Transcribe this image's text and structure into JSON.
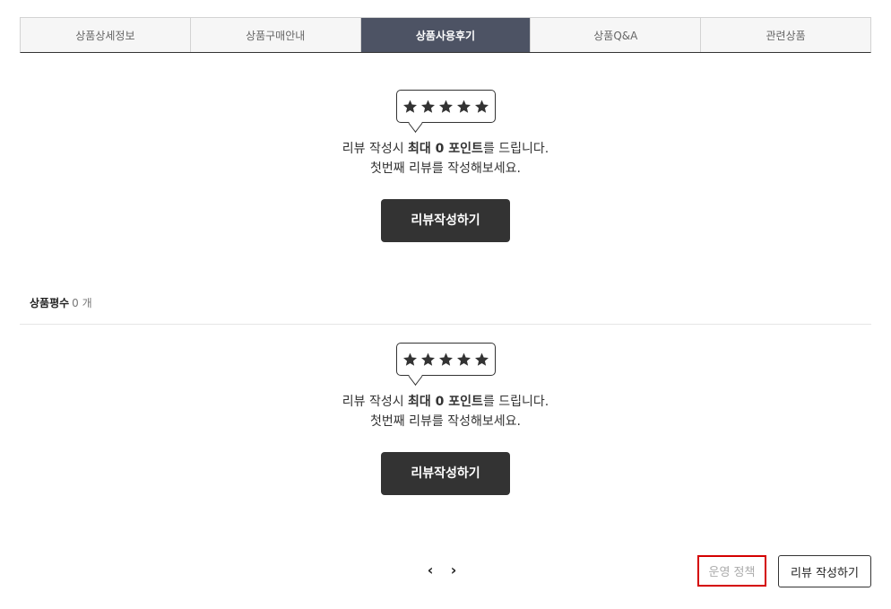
{
  "tabs": [
    {
      "label": "상품상세정보",
      "active": false
    },
    {
      "label": "상품구매안내",
      "active": false
    },
    {
      "label": "상품사용후기",
      "active": true
    },
    {
      "label": "상품Q&A",
      "active": false
    },
    {
      "label": "관련상품",
      "active": false
    }
  ],
  "empty_review": {
    "stars": 5,
    "star_icon": "star-icon",
    "line1_prefix": "리뷰 작성시 ",
    "line1_bold": "최대 0 포인트",
    "line1_suffix": "를 드립니다.",
    "line2": "첫번째 리뷰를 작성해보세요.",
    "button_label": "리뷰작성하기"
  },
  "rating_count": {
    "label": "상품평수",
    "value": "0 개"
  },
  "pagination": {
    "prev_icon": "chevron-left-icon",
    "next_icon": "chevron-right-icon",
    "prev_glyph": "‹",
    "next_glyph": "›"
  },
  "footer": {
    "policy_label": "운영 정책",
    "write_label": "리뷰 작성하기"
  },
  "colors": {
    "active_tab": "#4d5364",
    "dark_button": "#333333",
    "highlight": "#d40000"
  }
}
